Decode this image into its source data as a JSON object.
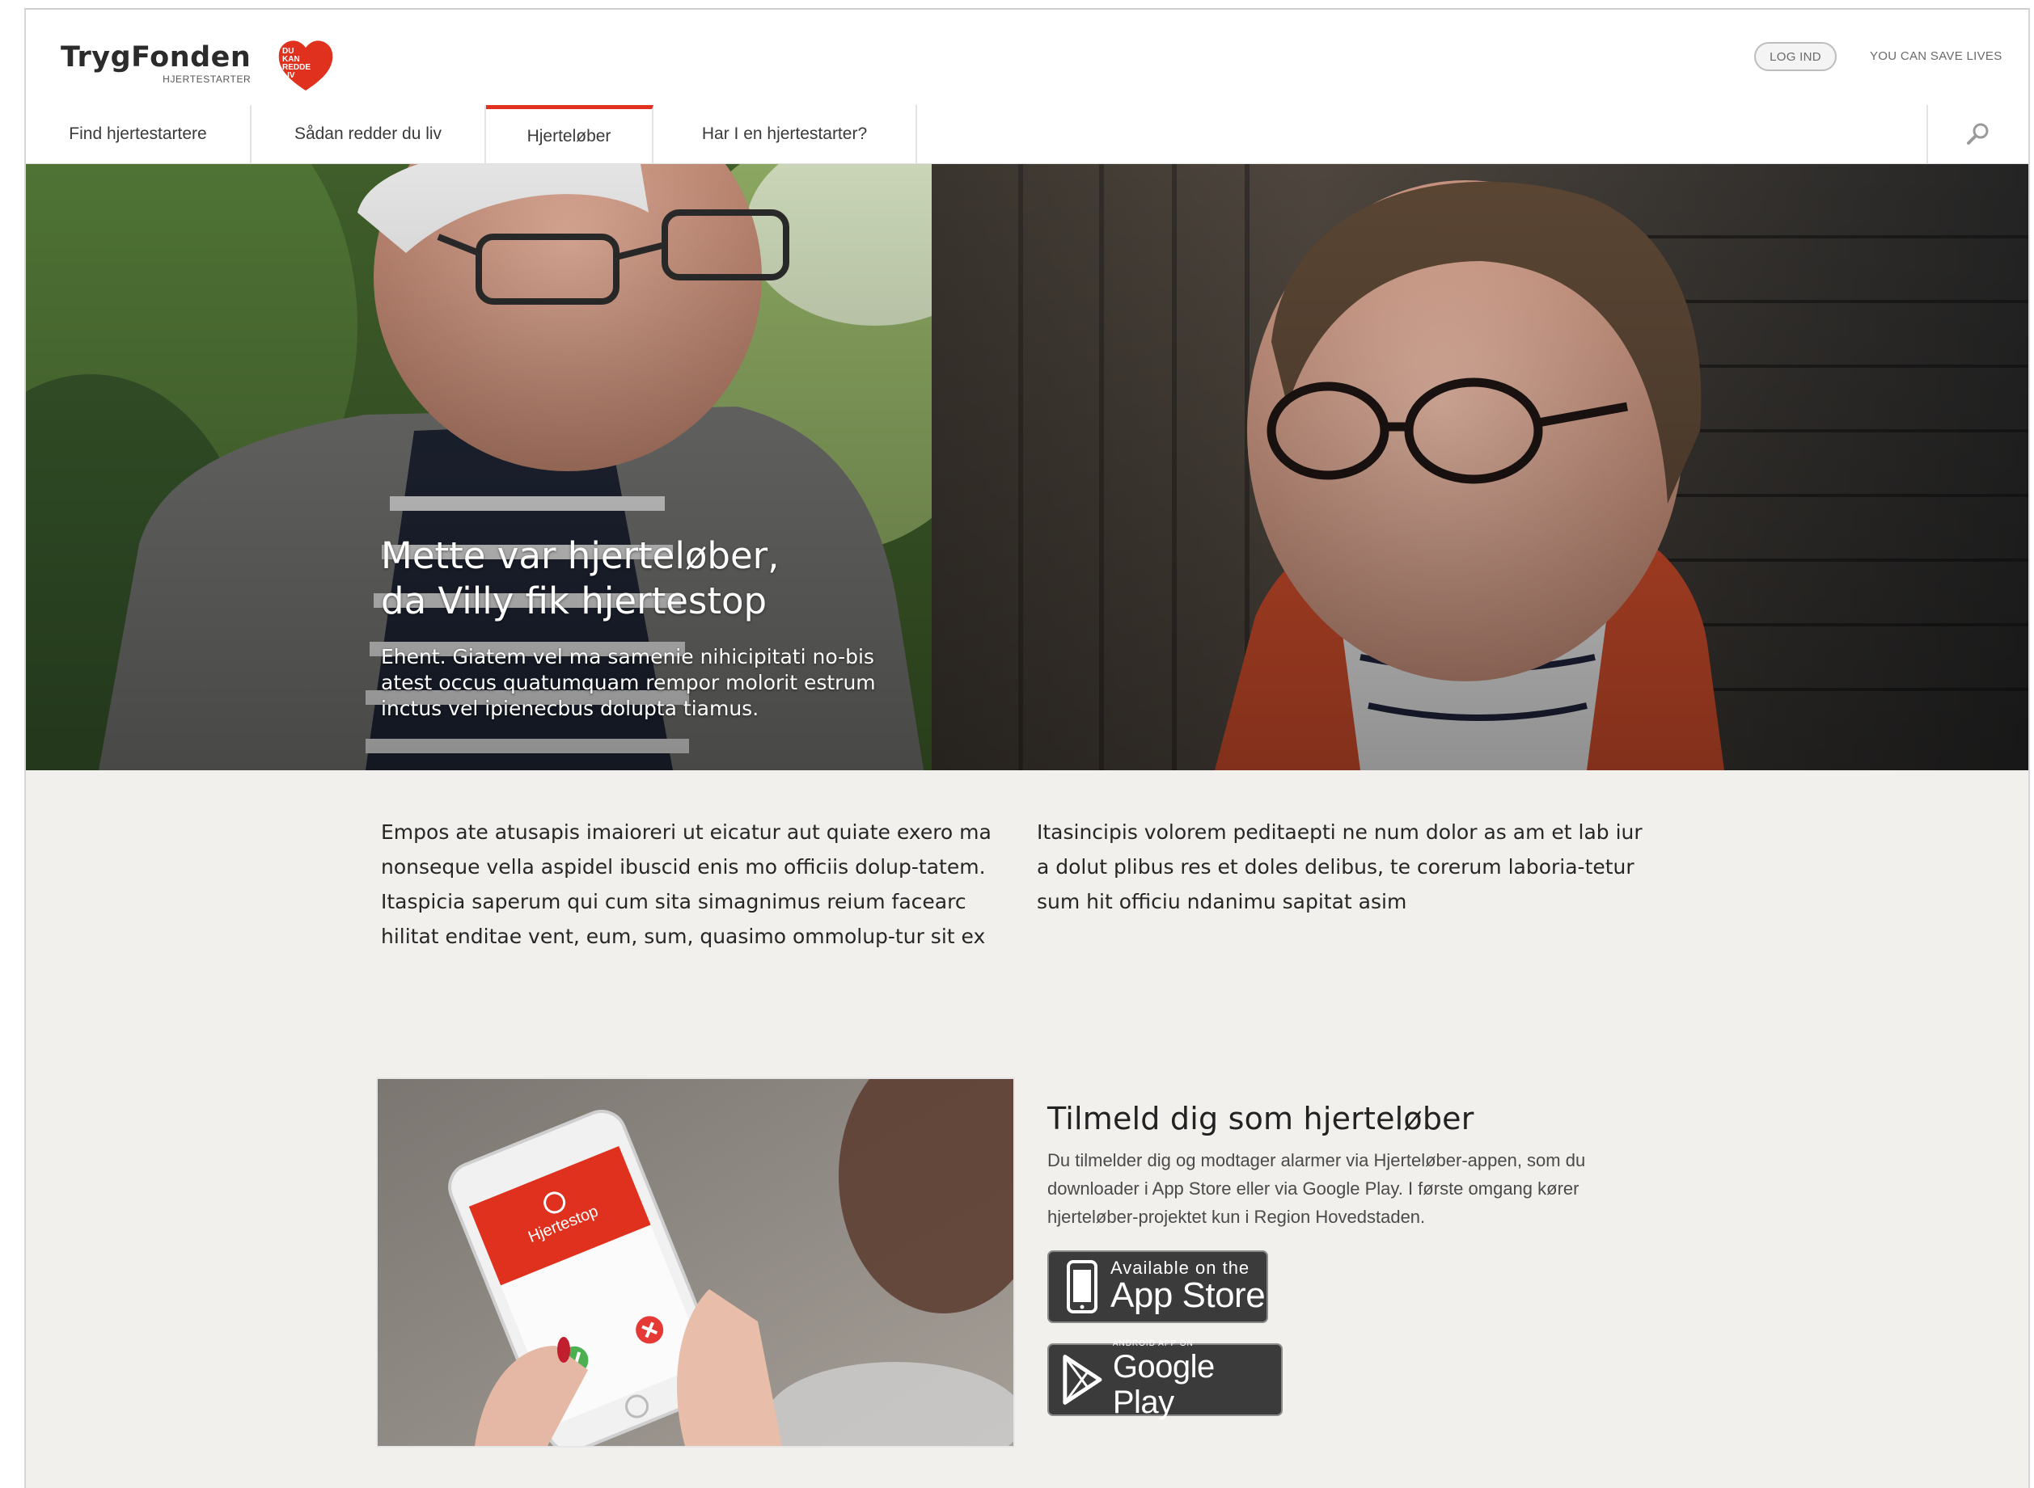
{
  "header": {
    "logo_word": "TrygFonden",
    "logo_sub": "HJERTESTARTER",
    "heart_lines": [
      "DU",
      "KAN",
      "REDDE",
      "LIV"
    ],
    "login_label": "LOG IND",
    "tagline": "YOU CAN SAVE LIVES"
  },
  "nav": {
    "items": [
      {
        "label": "Find hjertestartere",
        "active": false
      },
      {
        "label": "Sådan redder du liv",
        "active": false
      },
      {
        "label": "Hjerteløber",
        "active": true
      },
      {
        "label": "Har I en hjertestarter?",
        "active": false
      }
    ],
    "search_icon": "search-icon"
  },
  "hero": {
    "title_line1": "Mette var hjerteløber,",
    "title_line2": "da Villy fik hjertestop",
    "text": "Ehent. Giatem vel ma samenie nihicipitati no-bis atest occus quatumquam rempor molorit estrum inctus vel ipienecbus dolupta tiamus."
  },
  "intro": {
    "left": "Empos ate atusapis imaioreri ut eicatur aut quiate exero ma nonseque vella aspidel ibuscid enis mo officiis dolup-tatem. Itaspicia saperum qui cum sita simagnimus reium facearc hilitat enditae vent, eum, sum, quasimo ommolup-tur sit ex",
    "right": "Itasincipis volorem peditaepti ne num dolor as am et lab iur a dolut plibus res et doles delibus, te corerum laboria-tetur sum hit officiu ndanimu sapitat asim"
  },
  "app": {
    "title": "Tilmeld dig som hjerteløber",
    "description": "Du tilmelder dig og modtager alarmer via Hjerteløber-appen, som du downloader i App Store eller via Google Play. I første omgang kører hjerteløber-projektet kun i Region Hovedstaden.",
    "phone_screen_title": "Hjertestop",
    "appstore_small": "Available on the",
    "appstore_big": "App Store",
    "googleplay_small": "ANDROID APP ON",
    "googleplay_big": "Google Play"
  },
  "colors": {
    "accent_red": "#e0301e",
    "page_bg": "#f1f0ec",
    "badge_bg": "#3b3b3b"
  }
}
